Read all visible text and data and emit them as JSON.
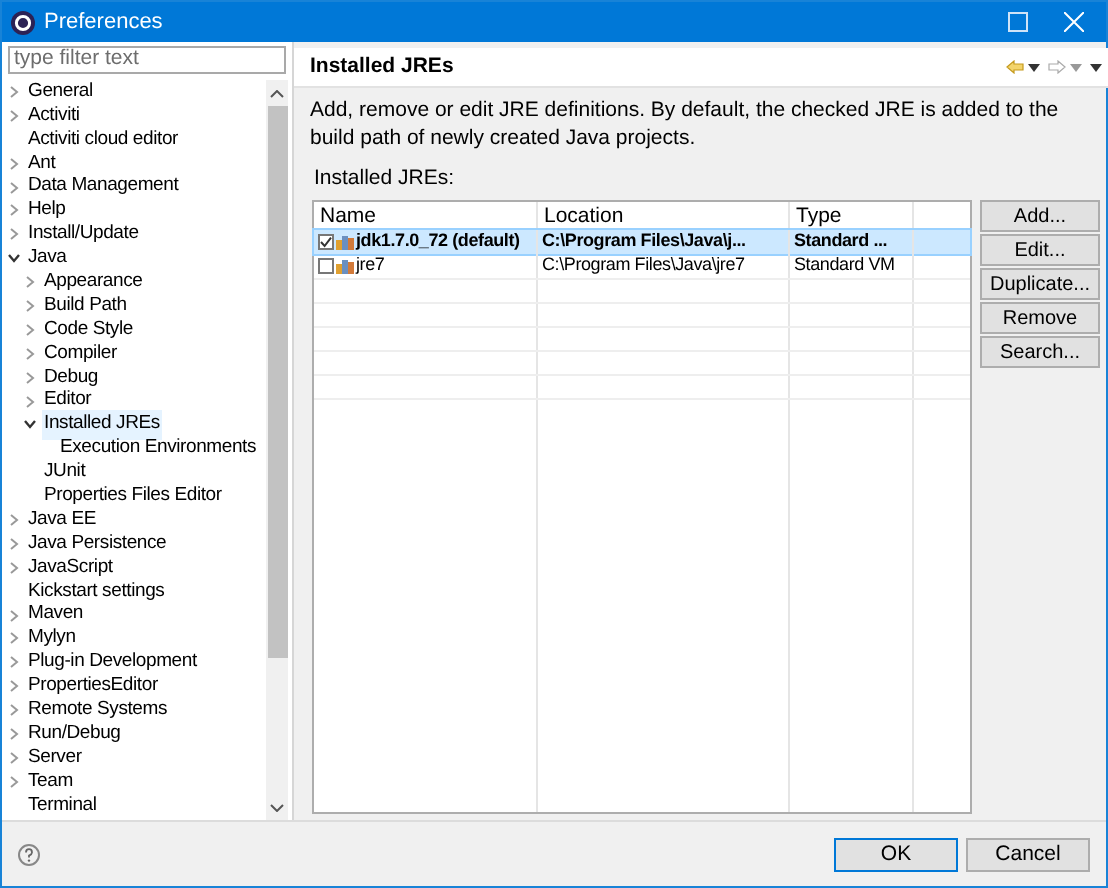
{
  "window": {
    "title": "Preferences"
  },
  "filter": {
    "placeholder": "type filter text"
  },
  "tree": [
    {
      "label": "General",
      "expanded": false,
      "selected": false
    },
    {
      "label": "Activiti",
      "expanded": false,
      "selected": false
    },
    {
      "label": "Activiti cloud editor",
      "selected": false
    },
    {
      "label": "Ant",
      "expanded": false,
      "selected": false
    },
    {
      "label": "Data Management",
      "expanded": false,
      "selected": false
    },
    {
      "label": "Help",
      "expanded": false,
      "selected": false
    },
    {
      "label": "Install/Update",
      "expanded": false,
      "selected": false
    },
    {
      "label": "Java",
      "expanded": true,
      "selected": false,
      "children": [
        {
          "label": "Appearance",
          "expanded": false,
          "selected": false
        },
        {
          "label": "Build Path",
          "expanded": false,
          "selected": false
        },
        {
          "label": "Code Style",
          "expanded": false,
          "selected": false
        },
        {
          "label": "Compiler",
          "expanded": false,
          "selected": false
        },
        {
          "label": "Debug",
          "expanded": false,
          "selected": false
        },
        {
          "label": "Editor",
          "expanded": false,
          "selected": false
        },
        {
          "label": "Installed JREs",
          "expanded": true,
          "selected": true,
          "children": [
            {
              "label": "Execution Environments",
              "selected": false
            }
          ]
        },
        {
          "label": "JUnit",
          "selected": false
        },
        {
          "label": "Properties Files Editor",
          "selected": false
        }
      ]
    },
    {
      "label": "Java EE",
      "expanded": false,
      "selected": false
    },
    {
      "label": "Java Persistence",
      "expanded": false,
      "selected": false
    },
    {
      "label": "JavaScript",
      "expanded": false,
      "selected": false
    },
    {
      "label": "Kickstart settings",
      "selected": false
    },
    {
      "label": "Maven",
      "expanded": false,
      "selected": false
    },
    {
      "label": "Mylyn",
      "expanded": false,
      "selected": false
    },
    {
      "label": "Plug-in Development",
      "expanded": false,
      "selected": false
    },
    {
      "label": "PropertiesEditor",
      "expanded": false,
      "selected": false
    },
    {
      "label": "Remote Systems",
      "expanded": false,
      "selected": false
    },
    {
      "label": "Run/Debug",
      "expanded": false,
      "selected": false
    },
    {
      "label": "Server",
      "expanded": false,
      "selected": false
    },
    {
      "label": "Team",
      "expanded": false,
      "selected": false
    },
    {
      "label": "Terminal",
      "selected": false
    }
  ],
  "page": {
    "title": "Installed JREs",
    "description": "Add, remove or edit JRE definitions. By default, the checked JRE is added to the build path of newly created Java projects.",
    "table_label": "Installed JREs:"
  },
  "table": {
    "columns": [
      "Name",
      "Location",
      "Type"
    ],
    "rows": [
      {
        "name": "jdk1.7.0_72 (default)",
        "location": "C:\\Program Files\\Java\\j...",
        "type": "Standard ...",
        "checked": true,
        "selected": true
      },
      {
        "name": "jre7",
        "location": "C:\\Program Files\\Java\\jre7",
        "type": "Standard VM",
        "checked": false,
        "selected": false
      }
    ]
  },
  "side_buttons": [
    "Add...",
    "Edit...",
    "Duplicate...",
    "Remove",
    "Search..."
  ],
  "footer_buttons": [
    {
      "label": "OK",
      "default": true
    },
    {
      "label": "Cancel",
      "default": false
    }
  ]
}
